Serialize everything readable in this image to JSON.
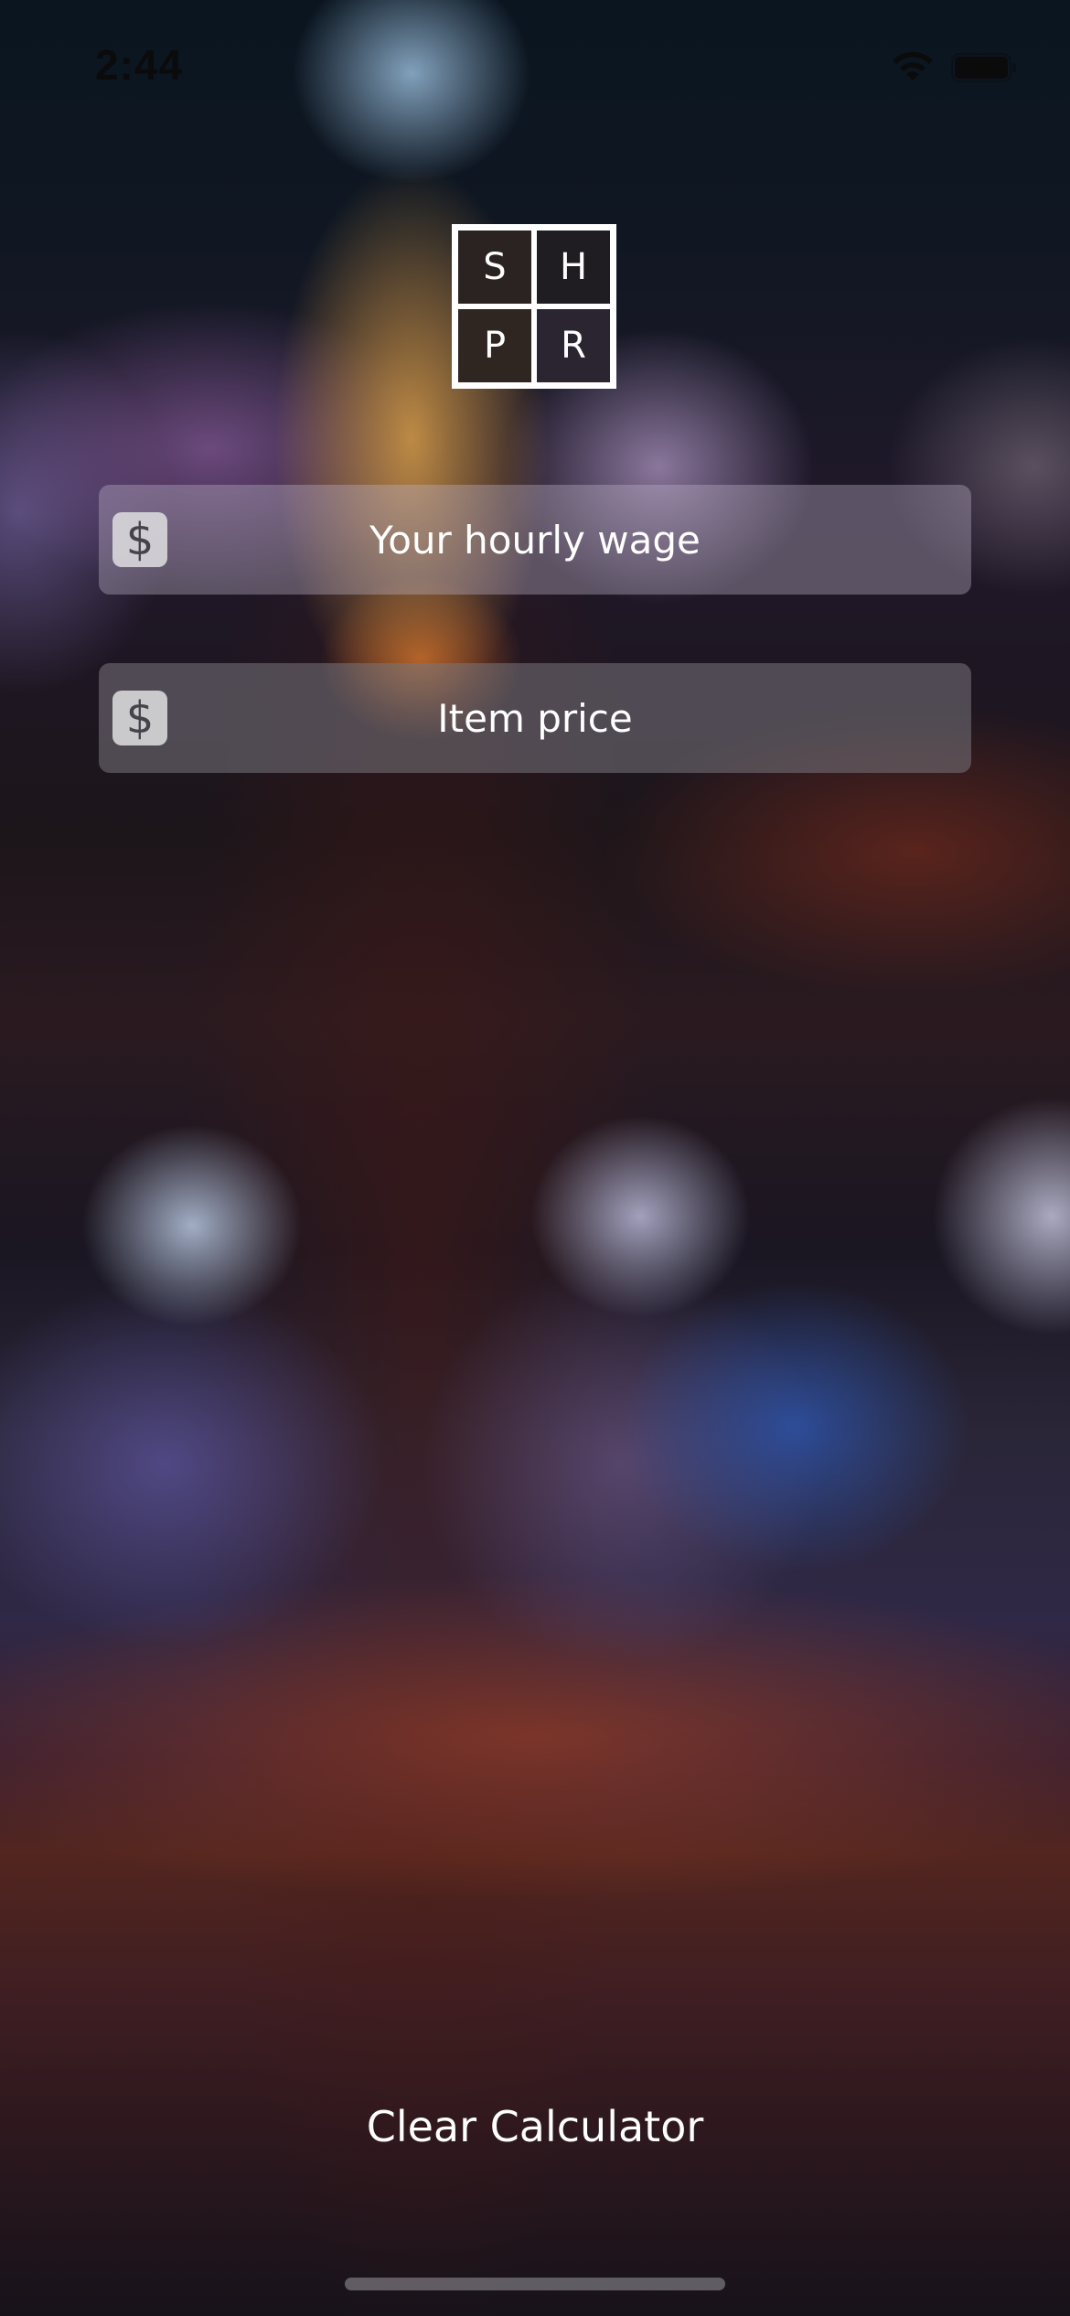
{
  "status_bar": {
    "time": "2:44",
    "wifi_icon": "wifi-icon",
    "battery_icon": "battery-icon"
  },
  "logo": {
    "letters": [
      "S",
      "H",
      "P",
      "R"
    ]
  },
  "form": {
    "hourly_wage": {
      "currency_symbol": "$",
      "placeholder": "Your hourly wage",
      "value": ""
    },
    "item_price": {
      "currency_symbol": "$",
      "placeholder": "Item price",
      "value": ""
    }
  },
  "actions": {
    "clear_label": "Clear Calculator"
  },
  "colors": {
    "text": "#ffffff",
    "badge_background": "#dcdcde",
    "badge_symbol": "#45444a"
  }
}
